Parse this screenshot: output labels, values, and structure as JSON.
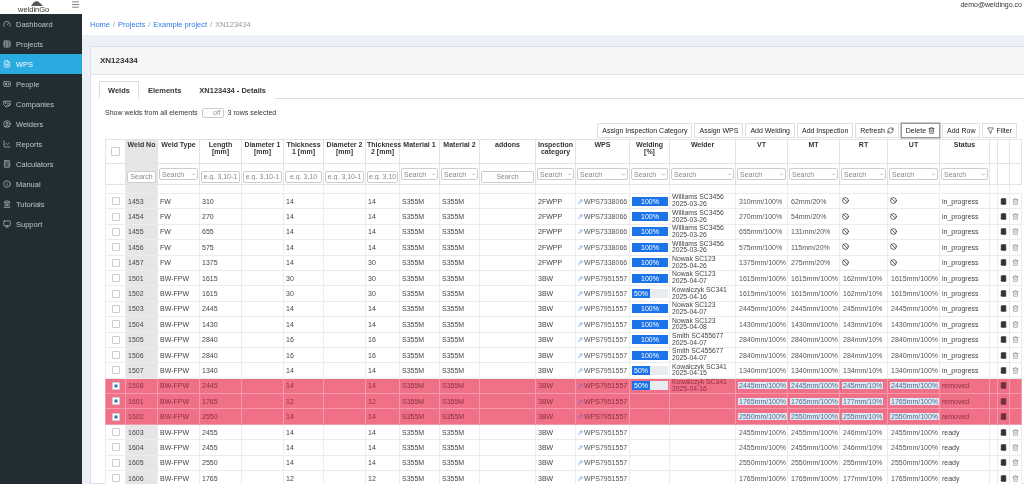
{
  "header": {
    "logo": "weldinGo",
    "user": "demo@weldingo.co"
  },
  "sidebar": {
    "items": [
      {
        "label": "Dashboard",
        "selected": false
      },
      {
        "label": "Projects",
        "selected": false
      },
      {
        "label": "WPS",
        "selected": true
      },
      {
        "label": "People",
        "selected": false
      },
      {
        "label": "Companies",
        "selected": false
      },
      {
        "label": "Welders",
        "selected": false
      },
      {
        "label": "Reports",
        "selected": false
      },
      {
        "label": "Calculators",
        "selected": false
      },
      {
        "label": "Manual",
        "selected": false
      },
      {
        "label": "Tutorials",
        "selected": false
      },
      {
        "label": "Support",
        "selected": false
      }
    ]
  },
  "breadcrumb": [
    {
      "label": "Home",
      "link": true
    },
    {
      "separator": "/",
      "label": "Projects",
      "link": true
    },
    {
      "separator": "/",
      "label": "Example project",
      "link": true
    },
    {
      "separator": "/",
      "label": "XN123434",
      "link": false
    }
  ],
  "card": {
    "title": "XN123434"
  },
  "tabs": [
    {
      "label": "Welds",
      "selected": true
    },
    {
      "label": "Elements",
      "selected": false
    },
    {
      "label": "XN123434 - Details",
      "selected": false
    }
  ],
  "show_all": {
    "label": "Show welds from all elements",
    "on": false,
    "toggle_text": "off",
    "selection_info": "3 rows selected"
  },
  "toolbar": [
    {
      "label": "Assign Inspection Category",
      "focused": false
    },
    {
      "label": "Assign WPS",
      "focused": false
    },
    {
      "label": "Add Welding",
      "focused": false
    },
    {
      "label": "Add Inspection",
      "focused": false
    },
    {
      "label": "Refresh",
      "focused": false
    },
    {
      "label": "Delete",
      "focused": true
    },
    {
      "label": "Add Row",
      "focused": false
    },
    {
      "label": "Filter",
      "focused": false
    }
  ],
  "table": {
    "select_all": {
      "checked": false
    },
    "columns": [
      {
        "label": "Weld No",
        "filter": {
          "kind": "input",
          "placeholder": "Search"
        }
      },
      {
        "label": "Weld Type",
        "filter": {
          "kind": "select",
          "placeholder": "Search"
        }
      },
      {
        "label": "Length [mm]",
        "filter": {
          "kind": "input",
          "placeholder": "e.g. 3,10-1"
        }
      },
      {
        "label": "Diameter 1 [mm]",
        "filter": {
          "kind": "input",
          "placeholder": "e.g. 3,10-1"
        }
      },
      {
        "label": "Thickness 1 [mm]",
        "filter": {
          "kind": "input",
          "placeholder": "e.g. 3,10"
        }
      },
      {
        "label": "Diameter 2 [mm]",
        "filter": {
          "kind": "input",
          "placeholder": "e.g. 3,10-1"
        }
      },
      {
        "label": "Thickness 2 [mm]",
        "filter": {
          "kind": "input",
          "placeholder": "e.g. 3,10"
        }
      },
      {
        "label": "Material 1",
        "filter": {
          "kind": "select",
          "placeholder": "Search"
        }
      },
      {
        "label": "Material 2",
        "filter": {
          "kind": "select",
          "placeholder": "Search"
        }
      },
      {
        "label": "addons",
        "filter": {
          "kind": "input",
          "placeholder": "Search"
        }
      },
      {
        "label": "Inspection category",
        "filter": {
          "kind": "select",
          "placeholder": "Search"
        }
      },
      {
        "label": "WPS",
        "filter": {
          "kind": "select",
          "placeholder": "Search"
        }
      },
      {
        "label": "Welding [%]",
        "filter": {
          "kind": "select",
          "placeholder": "Search"
        }
      },
      {
        "label": "Welder",
        "filter": {
          "kind": "select",
          "placeholder": "Search"
        }
      },
      {
        "label": "VT",
        "filter": {
          "kind": "select",
          "placeholder": "Search"
        }
      },
      {
        "label": "MT",
        "filter": {
          "kind": "select",
          "placeholder": "Search"
        }
      },
      {
        "label": "RT",
        "filter": {
          "kind": "select",
          "placeholder": "Search"
        }
      },
      {
        "label": "UT",
        "filter": {
          "kind": "select",
          "placeholder": "Search"
        }
      },
      {
        "label": "Status",
        "filter": {
          "kind": "select",
          "placeholder": "Search"
        }
      }
    ],
    "rows": [
      {
        "weld_no": "1453",
        "weld_type": "FW",
        "length": "310",
        "thickness_1": "14",
        "thickness_2": "14",
        "material_1": "S355M",
        "material_2": "S355M",
        "inspection_category": "2FWPP",
        "wps": "WPS7338066",
        "welding": {
          "level": 1,
          "label": "100%"
        },
        "welder": {
          "name": "Williams SC3456",
          "date": "2025-03-26"
        },
        "inspections": [
          {
            "kind": "value",
            "text": "310mm/100%"
          },
          {
            "kind": "value",
            "text": "62mm/20%"
          },
          {
            "kind": "none"
          },
          {
            "kind": "none"
          }
        ],
        "status": "in_progress",
        "selected": false
      },
      {
        "weld_no": "1454",
        "weld_type": "FW",
        "length": "270",
        "thickness_1": "14",
        "thickness_2": "14",
        "material_1": "S355M",
        "material_2": "S355M",
        "inspection_category": "2FWPP",
        "wps": "WPS7338066",
        "welding": {
          "level": 1,
          "label": "100%"
        },
        "welder": {
          "name": "Williams SC3456",
          "date": "2025-03-26"
        },
        "inspections": [
          {
            "kind": "value",
            "text": "270mm/100%"
          },
          {
            "kind": "value",
            "text": "54mm/20%"
          },
          {
            "kind": "none"
          },
          {
            "kind": "none"
          }
        ],
        "status": "in_progress",
        "selected": false
      },
      {
        "weld_no": "1455",
        "weld_type": "FW",
        "length": "655",
        "thickness_1": "14",
        "thickness_2": "14",
        "material_1": "S355M",
        "material_2": "S355M",
        "inspection_category": "2FWPP",
        "wps": "WPS7338066",
        "welding": {
          "level": 1,
          "label": "100%"
        },
        "welder": {
          "name": "Williams SC3456",
          "date": "2025-03-26"
        },
        "inspections": [
          {
            "kind": "value",
            "text": "655mm/100%"
          },
          {
            "kind": "value",
            "text": "131mm/20%"
          },
          {
            "kind": "none"
          },
          {
            "kind": "none"
          }
        ],
        "status": "in_progress",
        "selected": false
      },
      {
        "weld_no": "1456",
        "weld_type": "FW",
        "length": "575",
        "thickness_1": "14",
        "thickness_2": "14",
        "material_1": "S355M",
        "material_2": "S355M",
        "inspection_category": "2FWPP",
        "wps": "WPS7338066",
        "welding": {
          "level": 1,
          "label": "100%"
        },
        "welder": {
          "name": "Williams SC3456",
          "date": "2025-03-26"
        },
        "inspections": [
          {
            "kind": "value",
            "text": "575mm/100%"
          },
          {
            "kind": "value",
            "text": "115mm/20%"
          },
          {
            "kind": "none"
          },
          {
            "kind": "none"
          }
        ],
        "status": "in_progress",
        "selected": false
      },
      {
        "weld_no": "1457",
        "weld_type": "FW",
        "length": "1375",
        "thickness_1": "14",
        "thickness_2": "30",
        "material_1": "S355M",
        "material_2": "S355M",
        "inspection_category": "2FWPP",
        "wps": "WPS7338066",
        "welding": {
          "level": 1,
          "label": "100%"
        },
        "welder": {
          "name": "Nowak SC123",
          "date": "2025-04-26"
        },
        "inspections": [
          {
            "kind": "value",
            "text": "1375mm/100%"
          },
          {
            "kind": "value",
            "text": "275mm/20%"
          },
          {
            "kind": "none"
          },
          {
            "kind": "none"
          }
        ],
        "status": "in_progress",
        "selected": false
      },
      {
        "weld_no": "1501",
        "weld_type": "BW-FPW",
        "length": "1615",
        "thickness_1": "30",
        "thickness_2": "30",
        "material_1": "S355M",
        "material_2": "S355M",
        "inspection_category": "3BW",
        "wps": "WPS7951557",
        "welding": {
          "level": 1,
          "label": "100%"
        },
        "welder": {
          "name": "Nowak SC123",
          "date": "2025-04-07"
        },
        "inspections": [
          {
            "kind": "value",
            "text": "1615mm/100%"
          },
          {
            "kind": "value",
            "text": "1615mm/100%"
          },
          {
            "kind": "value",
            "text": "162mm/10%"
          },
          {
            "kind": "value",
            "text": "1615mm/100%"
          }
        ],
        "status": "in_progress",
        "selected": false
      },
      {
        "weld_no": "1502",
        "weld_type": "BW-FPW",
        "length": "1615",
        "thickness_1": "30",
        "thickness_2": "30",
        "material_1": "S355M",
        "material_2": "S355M",
        "inspection_category": "3BW",
        "wps": "WPS7951557",
        "welding": {
          "level": 0.5,
          "label": "50%"
        },
        "welder": {
          "name": "Kowalczyk SC341",
          "date": "2025-04-16"
        },
        "inspections": [
          {
            "kind": "value",
            "text": "1615mm/100%"
          },
          {
            "kind": "value",
            "text": "1615mm/100%"
          },
          {
            "kind": "value",
            "text": "162mm/10%"
          },
          {
            "kind": "value",
            "text": "1615mm/100%"
          }
        ],
        "status": "in_progress",
        "selected": false
      },
      {
        "weld_no": "1503",
        "weld_type": "BW-FPW",
        "length": "2445",
        "thickness_1": "14",
        "thickness_2": "14",
        "material_1": "S355M",
        "material_2": "S355M",
        "inspection_category": "3BW",
        "wps": "WPS7951557",
        "welding": {
          "level": 1,
          "label": "100%"
        },
        "welder": {
          "name": "Nowak SC123",
          "date": "2025-04-07"
        },
        "inspections": [
          {
            "kind": "value",
            "text": "2445mm/100%"
          },
          {
            "kind": "value",
            "text": "2445mm/100%"
          },
          {
            "kind": "value",
            "text": "245mm/10%"
          },
          {
            "kind": "value",
            "text": "2445mm/100%"
          }
        ],
        "status": "in_progress",
        "selected": false
      },
      {
        "weld_no": "1504",
        "weld_type": "BW-FPW",
        "length": "1430",
        "thickness_1": "14",
        "thickness_2": "14",
        "material_1": "S355M",
        "material_2": "S355M",
        "inspection_category": "3BW",
        "wps": "WPS7951557",
        "welding": {
          "level": 1,
          "label": "100%"
        },
        "welder": {
          "name": "Nowak SC123",
          "date": "2025-04-08"
        },
        "inspections": [
          {
            "kind": "value",
            "text": "1430mm/100%"
          },
          {
            "kind": "value",
            "text": "1430mm/100%"
          },
          {
            "kind": "value",
            "text": "143mm/10%"
          },
          {
            "kind": "value",
            "text": "1430mm/100%"
          }
        ],
        "status": "in_progress",
        "selected": false
      },
      {
        "weld_no": "1505",
        "weld_type": "BW-FPW",
        "length": "2840",
        "thickness_1": "16",
        "thickness_2": "16",
        "material_1": "S355M",
        "material_2": "S355M",
        "inspection_category": "3BW",
        "wps": "WPS7951557",
        "welding": {
          "level": 1,
          "label": "100%"
        },
        "welder": {
          "name": "Smith SC455677",
          "date": "2025-04-07"
        },
        "inspections": [
          {
            "kind": "value",
            "text": "2840mm/100%"
          },
          {
            "kind": "value",
            "text": "2840mm/100%"
          },
          {
            "kind": "value",
            "text": "284mm/10%"
          },
          {
            "kind": "value",
            "text": "2840mm/100%"
          }
        ],
        "status": "in_progress",
        "selected": false
      },
      {
        "weld_no": "1506",
        "weld_type": "BW-FPW",
        "length": "2840",
        "thickness_1": "16",
        "thickness_2": "16",
        "material_1": "S355M",
        "material_2": "S355M",
        "inspection_category": "3BW",
        "wps": "WPS7951557",
        "welding": {
          "level": 1,
          "label": "100%"
        },
        "welder": {
          "name": "Smith SC455677",
          "date": "2025-04-07"
        },
        "inspections": [
          {
            "kind": "value",
            "text": "2840mm/100%"
          },
          {
            "kind": "value",
            "text": "2840mm/100%"
          },
          {
            "kind": "value",
            "text": "284mm/10%"
          },
          {
            "kind": "value",
            "text": "2840mm/100%"
          }
        ],
        "status": "in_progress",
        "selected": false
      },
      {
        "weld_no": "1507",
        "weld_type": "BW-FPW",
        "length": "1340",
        "thickness_1": "14",
        "thickness_2": "14",
        "material_1": "S355M",
        "material_2": "S355M",
        "inspection_category": "3BW",
        "wps": "WPS7951557",
        "welding": {
          "level": 0.5,
          "label": "50%"
        },
        "welder": {
          "name": "Kowalczyk SC341",
          "date": "2025-04-15"
        },
        "inspections": [
          {
            "kind": "value",
            "text": "1340mm/100%"
          },
          {
            "kind": "value",
            "text": "1340mm/100%"
          },
          {
            "kind": "value",
            "text": "134mm/10%"
          },
          {
            "kind": "value",
            "text": "1340mm/100%"
          }
        ],
        "status": "in_progress",
        "selected": false
      },
      {
        "weld_no": "1508",
        "weld_type": "BW-FPW",
        "length": "2445",
        "thickness_1": "14",
        "thickness_2": "14",
        "material_1": "S355M",
        "material_2": "S355M",
        "inspection_category": "3BW",
        "wps": "WPS7951557",
        "welding": {
          "level": 0.5,
          "label": "50%"
        },
        "welder": {
          "name": "Kowalczyk SC341",
          "date": "2025-04-16"
        },
        "inspections": [
          {
            "kind": "value",
            "text": "2445mm/100%"
          },
          {
            "kind": "value",
            "text": "2445mm/100%"
          },
          {
            "kind": "value",
            "text": "245mm/10%"
          },
          {
            "kind": "value",
            "text": "2445mm/100%"
          }
        ],
        "status": "removed",
        "selected": true
      },
      {
        "weld_no": "1601",
        "weld_type": "BW-FPW",
        "length": "1765",
        "thickness_1": "12",
        "thickness_2": "12",
        "material_1": "S355M",
        "material_2": "S355M",
        "inspection_category": "3BW",
        "wps": "WPS7951557",
        "inspections": [
          {
            "kind": "value",
            "text": "1765mm/100%"
          },
          {
            "kind": "value",
            "text": "1765mm/100%"
          },
          {
            "kind": "value",
            "text": "177mm/10%"
          },
          {
            "kind": "value",
            "text": "1765mm/100%"
          }
        ],
        "status": "removed",
        "selected": true
      },
      {
        "weld_no": "1602",
        "weld_type": "BW-FPW",
        "length": "2550",
        "thickness_1": "14",
        "thickness_2": "14",
        "material_1": "S355M",
        "material_2": "S355M",
        "inspection_category": "3BW",
        "wps": "WPS7951557",
        "inspections": [
          {
            "kind": "value",
            "text": "2550mm/100%"
          },
          {
            "kind": "value",
            "text": "2550mm/100%"
          },
          {
            "kind": "value",
            "text": "255mm/10%"
          },
          {
            "kind": "value",
            "text": "2550mm/100%"
          }
        ],
        "status": "removed",
        "selected": true
      },
      {
        "weld_no": "1603",
        "weld_type": "BW-FPW",
        "length": "2455",
        "thickness_1": "14",
        "thickness_2": "14",
        "material_1": "S355M",
        "material_2": "S355M",
        "inspection_category": "3BW",
        "wps": "WPS7951557",
        "inspections": [
          {
            "kind": "value",
            "text": "2455mm/100%"
          },
          {
            "kind": "value",
            "text": "2455mm/100%"
          },
          {
            "kind": "value",
            "text": "246mm/10%"
          },
          {
            "kind": "value",
            "text": "2455mm/100%"
          }
        ],
        "status": "ready",
        "selected": false
      },
      {
        "weld_no": "1604",
        "weld_type": "BW-FPW",
        "length": "2455",
        "thickness_1": "14",
        "thickness_2": "14",
        "material_1": "S355M",
        "material_2": "S355M",
        "inspection_category": "3BW",
        "wps": "WPS7951557",
        "inspections": [
          {
            "kind": "value",
            "text": "2455mm/100%"
          },
          {
            "kind": "value",
            "text": "2455mm/100%"
          },
          {
            "kind": "value",
            "text": "246mm/10%"
          },
          {
            "kind": "value",
            "text": "2455mm/100%"
          }
        ],
        "status": "ready",
        "selected": false
      },
      {
        "weld_no": "1605",
        "weld_type": "BW-FPW",
        "length": "2550",
        "thickness_1": "14",
        "thickness_2": "14",
        "material_1": "S355M",
        "material_2": "S355M",
        "inspection_category": "3BW",
        "wps": "WPS7951557",
        "inspections": [
          {
            "kind": "value",
            "text": "2550mm/100%"
          },
          {
            "kind": "value",
            "text": "2550mm/100%"
          },
          {
            "kind": "value",
            "text": "255mm/10%"
          },
          {
            "kind": "value",
            "text": "2550mm/100%"
          }
        ],
        "status": "ready",
        "selected": false
      },
      {
        "weld_no": "1606",
        "weld_type": "BW-FPW",
        "length": "1765",
        "thickness_1": "12",
        "thickness_2": "12",
        "material_1": "S355M",
        "material_2": "S355M",
        "inspection_category": "3BW",
        "wps": "WPS7951557",
        "inspections": [
          {
            "kind": "value",
            "text": "1765mm/100%"
          },
          {
            "kind": "value",
            "text": "1765mm/100%"
          },
          {
            "kind": "value",
            "text": "177mm/10%"
          },
          {
            "kind": "value",
            "text": "1765mm/100%"
          }
        ],
        "status": "ready",
        "selected": false
      }
    ]
  }
}
